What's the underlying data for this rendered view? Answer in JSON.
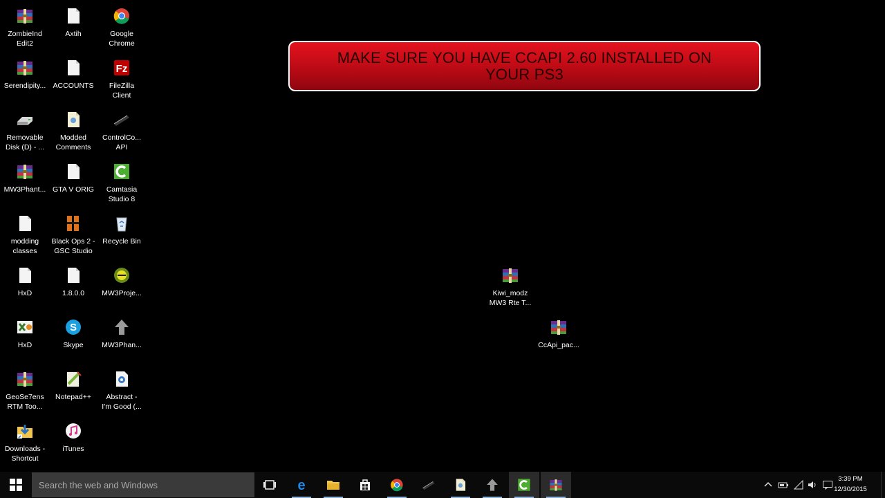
{
  "desktop": {
    "icons": [
      {
        "label": "ZombieInd\nEdit2",
        "icon": "winrar-archive-icon"
      },
      {
        "label": "Serendipity...",
        "icon": "winrar-archive-icon"
      },
      {
        "label": "Removable\nDisk (D) - ...",
        "icon": "removable-drive-icon"
      },
      {
        "label": "MW3Phant...",
        "icon": "winrar-archive-icon"
      },
      {
        "label": "modding\nclasses",
        "icon": "document-icon"
      },
      {
        "label": "HxD",
        "icon": "document-icon"
      },
      {
        "label": "HxD",
        "icon": "hxd-app-icon"
      },
      {
        "label": "GeoSe7ens\nRTM Too...",
        "icon": "winrar-archive-icon"
      },
      {
        "label": "Downloads -\nShortcut",
        "icon": "downloads-shortcut-icon"
      },
      {
        "label": "Axtih",
        "icon": "document-icon"
      },
      {
        "label": "ACCOUNTS",
        "icon": "document-icon"
      },
      {
        "label": "Modded\nComments",
        "icon": "text-file-icon"
      },
      {
        "label": "GTA V ORIG",
        "icon": "document-icon"
      },
      {
        "label": "Black Ops 2 -\nGSC Studio",
        "icon": "gsc-studio-icon"
      },
      {
        "label": "1.8.0.0",
        "icon": "document-icon"
      },
      {
        "label": "Skype",
        "icon": "skype-icon"
      },
      {
        "label": "Notepad++",
        "icon": "notepad-plus-plus-icon"
      },
      {
        "label": "iTunes",
        "icon": "itunes-icon"
      },
      {
        "label": "Google\nChrome",
        "icon": "chrome-icon"
      },
      {
        "label": "FileZilla\nClient",
        "icon": "filezilla-icon"
      },
      {
        "label": "ControlCo...\nAPI",
        "icon": "control-console-api-icon"
      },
      {
        "label": "Camtasia\nStudio 8",
        "icon": "camtasia-icon"
      },
      {
        "label": "Recycle Bin",
        "icon": "recycle-bin-icon"
      },
      {
        "label": "MW3Proje...",
        "icon": "mw3-project-icon"
      },
      {
        "label": "MW3Phan...",
        "icon": "mw3-phantom-icon"
      },
      {
        "label": "Abstract -\nI'm Good (...",
        "icon": "audio-file-icon"
      },
      {
        "label": "Kiwi_modz\nMW3 Rte T...",
        "icon": "winrar-archive-icon"
      },
      {
        "label": "CcApi_pac...",
        "icon": "winrar-archive-icon"
      }
    ]
  },
  "banner": {
    "text": "MAKE SURE YOU HAVE CCAPI 2.60 INSTALLED ON YOUR PS3"
  },
  "taskbar": {
    "search_placeholder": "Search the web and Windows",
    "pinned": [
      {
        "name": "task-view",
        "icon": "task-view-icon"
      },
      {
        "name": "edge",
        "icon": "edge-icon"
      },
      {
        "name": "file-explorer",
        "icon": "folder-icon"
      },
      {
        "name": "store",
        "icon": "store-icon"
      },
      {
        "name": "chrome",
        "icon": "chrome-icon"
      },
      {
        "name": "controlconsole",
        "icon": "control-console-api-icon"
      },
      {
        "name": "notepad",
        "icon": "text-file-icon"
      },
      {
        "name": "mw3-phantom",
        "icon": "mw3-phantom-icon"
      },
      {
        "name": "camtasia",
        "icon": "camtasia-icon"
      },
      {
        "name": "winrar",
        "icon": "winrar-archive-icon"
      }
    ],
    "clock": {
      "time": "3:39 PM",
      "date": "12/30/2015"
    },
    "tray_icons": [
      "chevron-up-icon",
      "battery-icon",
      "network-icon",
      "volume-icon",
      "notifications-icon"
    ]
  },
  "colors": {
    "banner_red": "#d0101a",
    "taskbar": "#0a0a0a",
    "search_box": "#3a3a3a",
    "running_indicator": "#8fb2d9"
  }
}
